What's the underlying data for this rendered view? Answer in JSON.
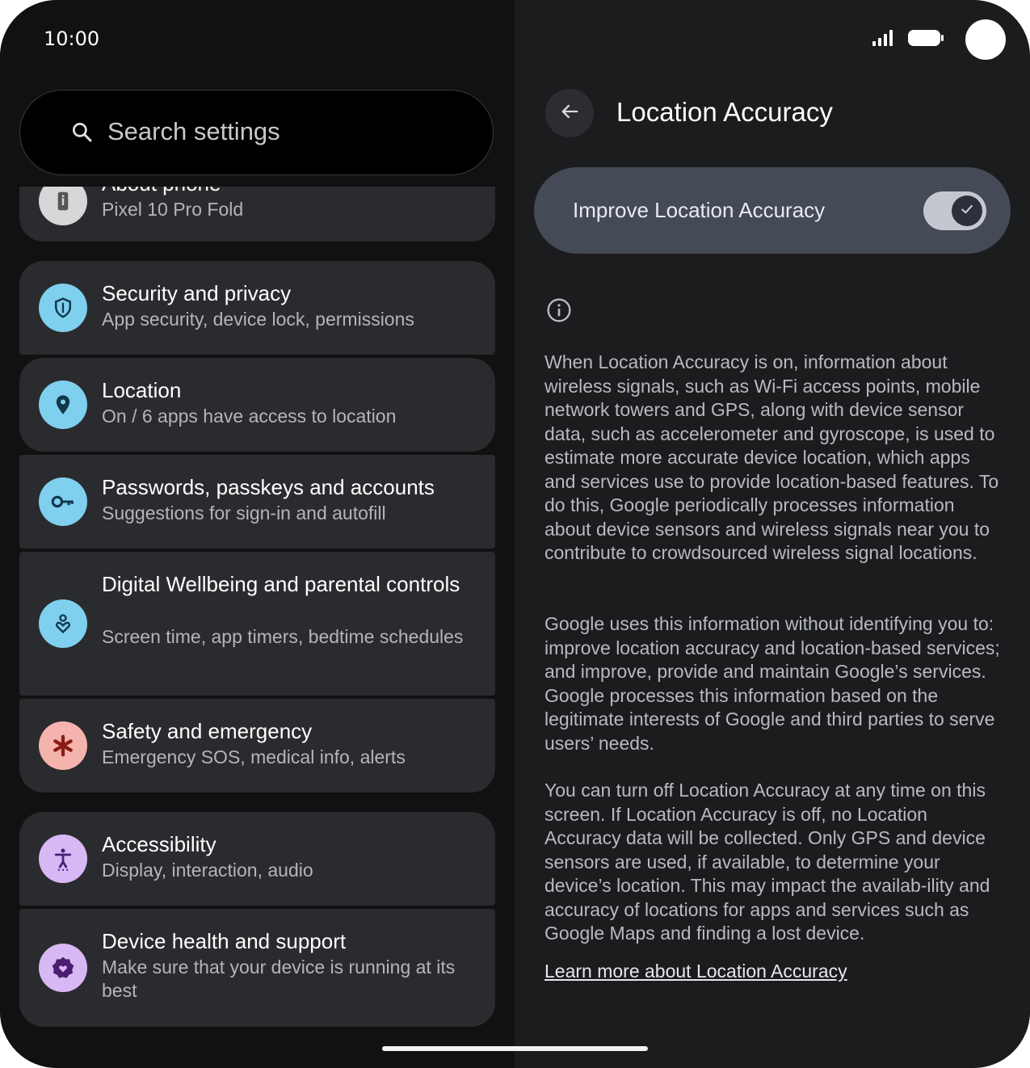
{
  "status_bar": {
    "time": "10:00"
  },
  "search": {
    "placeholder": "Search settings"
  },
  "settings_list": {
    "about": {
      "title": "About phone",
      "subtitle": "Pixel 10 Pro Fold"
    },
    "items": [
      {
        "title": "Security and privacy",
        "subtitle": "App security, device lock, permissions",
        "icon": "shield-icon"
      },
      {
        "title": "Location",
        "subtitle": "On / 6 apps have access to location",
        "icon": "location-pin-icon"
      },
      {
        "title": "Passwords, passkeys and accounts",
        "subtitle": "Suggestions for sign-in and autofill",
        "icon": "key-icon"
      },
      {
        "title": "Digital Wellbeing and parental controls",
        "subtitle": "Screen time, app timers, bedtime schedules",
        "icon": "wellbeing-icon"
      },
      {
        "title": "Safety and emergency",
        "subtitle": "Emergency SOS, medical info, alerts",
        "icon": "asterisk-icon"
      },
      {
        "title": "Accessibility",
        "subtitle": "Display, interaction, audio",
        "icon": "accessibility-icon"
      },
      {
        "title": "Device health and support",
        "subtitle": "Make sure that your device is running at its best",
        "icon": "device-health-icon"
      }
    ]
  },
  "detail": {
    "title": "Location Accuracy",
    "toggle": {
      "label": "Improve Location Accuracy",
      "on": true
    },
    "paragraphs": [
      "When Location Accuracy is on, information about wireless signals, such as Wi-Fi access points, mobile network towers and GPS, along with device sensor data, such as accelerometer and gyroscope, is used to estimate more accurate device location, which apps and services use to provide location-based features. To do this, Google periodically processes information about device sensors and wireless signals near you to contribute to crowdsourced wireless signal locations.",
      "Google uses this information without identifying you to: improve location accuracy and location-based services; and improve, provide and maintain Google’s services. Google processes this information based on the legitimate interests of Google and third parties to serve users’ needs.",
      "You can turn off Location Accuracy at any time on this screen. If Location Accuracy is off, no Location Accuracy data will be collected. Only GPS and device sensors are used, if available, to determine your device’s location. This may impact the availab-ility and accuracy of locations for apps and services such as Google Maps and finding a lost device."
    ],
    "learn_more": "Learn more about Location Accuracy"
  },
  "colors": {
    "icon_blue": "#7fcfee",
    "icon_pink": "#f4b4ad",
    "icon_purple": "#d7b8f4",
    "toggle_card": "#454a57"
  }
}
